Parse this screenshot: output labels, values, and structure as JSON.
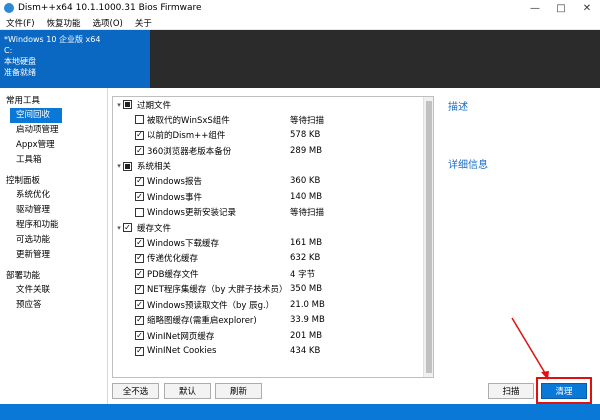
{
  "window": {
    "title": "Dism++x64 10.1.1000.31 Bios Firmware",
    "controls": [
      "—",
      "□",
      "✕"
    ]
  },
  "menu": [
    "文件(F)",
    "恢复功能",
    "选项(O)",
    "关于"
  ],
  "os_panel": {
    "name": "*Windows 10 企业版 x64",
    "drive": "C:",
    "disk": "本地硬盘",
    "status": "准备就绪"
  },
  "sidebar": {
    "groups": [
      {
        "label": "常用工具",
        "items": [
          "空间回收",
          "启动项管理",
          "Appx管理",
          "工具箱"
        ]
      },
      {
        "label": "控制面板",
        "items": [
          "系统优化",
          "驱动管理",
          "程序和功能",
          "可选功能",
          "更新管理"
        ]
      },
      {
        "label": "部署功能",
        "items": [
          "文件关联",
          "预应答"
        ]
      }
    ],
    "selected": "空间回收"
  },
  "cleanup_list": [
    {
      "category": "过期文件",
      "state": "partial",
      "items": [
        {
          "name": "被取代的WinSxS组件",
          "size": "等待扫描",
          "checked": false
        },
        {
          "name": "以前的Dism++组件",
          "size": "578 KB",
          "checked": true
        },
        {
          "name": "360浏览器老版本备份",
          "size": "289 MB",
          "checked": true
        }
      ]
    },
    {
      "category": "系统相关",
      "state": "partial",
      "items": [
        {
          "name": "Windows报告",
          "size": "360 KB",
          "checked": true
        },
        {
          "name": "Windows事件",
          "size": "140 MB",
          "checked": true
        },
        {
          "name": "Windows更新安装记录",
          "size": "等待扫描",
          "checked": false
        }
      ]
    },
    {
      "category": "缓存文件",
      "state": "checked",
      "items": [
        {
          "name": "Windows下载缓存",
          "size": "161 MB",
          "checked": true
        },
        {
          "name": "传递优化缓存",
          "size": "632 KB",
          "checked": true
        },
        {
          "name": "PDB缓存文件",
          "size": "4 字节",
          "checked": true
        },
        {
          "name": "NET程序集缓存（by 大胖子技术员）",
          "size": "350 MB",
          "checked": true
        },
        {
          "name": "Windows预读取文件（by 辰g.）",
          "size": "21.0 MB",
          "checked": true
        },
        {
          "name": "缩略图缓存(需重启explorer)",
          "size": "33.9 MB",
          "checked": true
        },
        {
          "name": "WinINet网页缓存",
          "size": "201 MB",
          "checked": true
        },
        {
          "name": "WinINet Cookies",
          "size": "434 KB",
          "checked": true
        }
      ]
    }
  ],
  "right_panel": {
    "description": "描述",
    "details": "详细信息"
  },
  "buttons": {
    "deselect_all": "全不选",
    "default": "默认",
    "refresh": "刷新",
    "scan": "扫描",
    "clean": "清理"
  },
  "colors": {
    "accent": "#0a78d7",
    "os_panel": "#0a68c2",
    "header_dark": "#2b2b2b",
    "highlight": "#e01010"
  }
}
